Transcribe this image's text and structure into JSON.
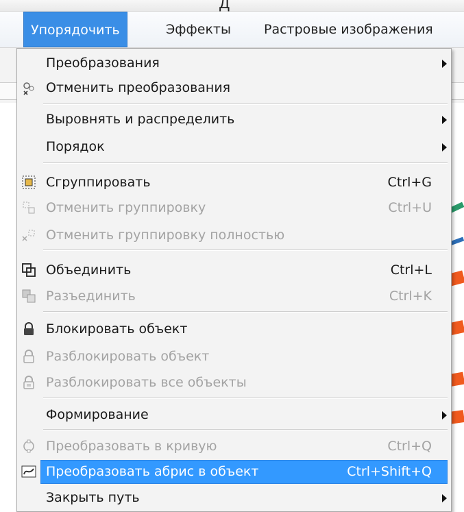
{
  "window": {
    "title_fragment": "Д"
  },
  "menubar": {
    "items": [
      {
        "label": "Упорядочить",
        "active": true
      },
      {
        "label": "Эффекты",
        "active": false
      },
      {
        "label": "Растровые изображения",
        "active": false
      }
    ]
  },
  "menu": {
    "items": [
      {
        "label": "Преобразования",
        "shortcut": "",
        "submenu": true,
        "disabled": false,
        "icon": ""
      },
      {
        "label": "Отменить преобразования",
        "shortcut": "",
        "submenu": false,
        "disabled": false,
        "icon": "clear-transformations-icon"
      },
      {
        "label": "Выровнять и распределить",
        "shortcut": "",
        "submenu": true,
        "disabled": false,
        "icon": ""
      },
      {
        "label": "Порядок",
        "shortcut": "",
        "submenu": true,
        "disabled": false,
        "icon": ""
      },
      {
        "label": "Сгруппировать",
        "shortcut": "Ctrl+G",
        "submenu": false,
        "disabled": false,
        "icon": "group-icon"
      },
      {
        "label": "Отменить группировку",
        "shortcut": "Ctrl+U",
        "submenu": false,
        "disabled": true,
        "icon": "ungroup-icon"
      },
      {
        "label": "Отменить группировку полностью",
        "shortcut": "",
        "submenu": false,
        "disabled": true,
        "icon": "ungroup-all-icon"
      },
      {
        "label": "Объединить",
        "shortcut": "Ctrl+L",
        "submenu": false,
        "disabled": false,
        "icon": "combine-icon"
      },
      {
        "label": "Разъединить",
        "shortcut": "Ctrl+K",
        "submenu": false,
        "disabled": true,
        "icon": "break-apart-icon"
      },
      {
        "label": "Блокировать объект",
        "shortcut": "",
        "submenu": false,
        "disabled": false,
        "icon": "lock-icon"
      },
      {
        "label": "Разблокировать объект",
        "shortcut": "",
        "submenu": false,
        "disabled": true,
        "icon": "unlock-icon"
      },
      {
        "label": "Разблокировать все объекты",
        "shortcut": "",
        "submenu": false,
        "disabled": true,
        "icon": "unlock-all-icon"
      },
      {
        "label": "Формирование",
        "shortcut": "",
        "submenu": true,
        "disabled": false,
        "icon": ""
      },
      {
        "label": "Преобразовать в кривую",
        "shortcut": "Ctrl+Q",
        "submenu": false,
        "disabled": true,
        "icon": "convert-to-curves-icon"
      },
      {
        "label": "Преобразовать абрис в объект",
        "shortcut": "Ctrl+Shift+Q",
        "submenu": false,
        "disabled": false,
        "highlighted": true,
        "icon": "outline-to-object-icon"
      },
      {
        "label": "Закрыть путь",
        "shortcut": "",
        "submenu": true,
        "disabled": false,
        "icon": ""
      }
    ]
  }
}
